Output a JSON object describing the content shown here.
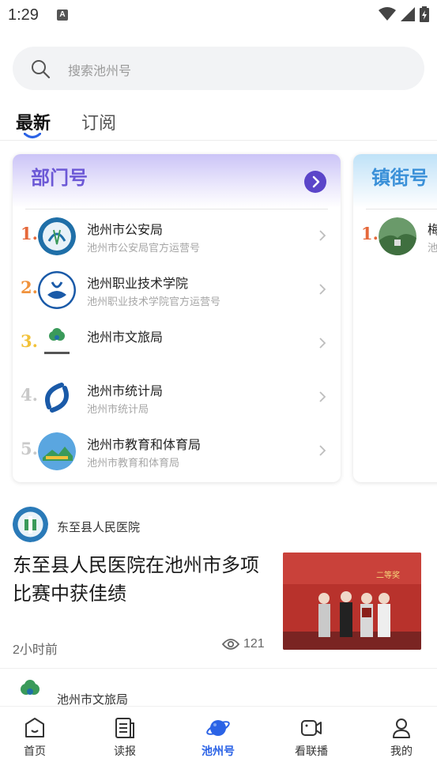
{
  "status_bar": {
    "time": "1:29",
    "notification_letter": "A"
  },
  "search": {
    "placeholder": "搜索池州号"
  },
  "tabs": [
    {
      "label": "最新",
      "active": true
    },
    {
      "label": "订阅",
      "active": false
    }
  ],
  "dept_card": {
    "title": "部门号",
    "items": [
      {
        "rank": "1.",
        "name": "池州市公安局",
        "desc": "池州市公安局官方运营号",
        "rank_color": "#e5683a"
      },
      {
        "rank": "2.",
        "name": "池州职业技术学院",
        "desc": "池州职业技术学院官方运营号",
        "rank_color": "#f0923c"
      },
      {
        "rank": "3.",
        "name": "池州市文旅局",
        "desc": "",
        "rank_color": "#f2c23a"
      },
      {
        "rank": "4.",
        "name": "池州市统计局",
        "desc": "池州市统计局",
        "rank_color": "#c9c9c9"
      },
      {
        "rank": "5.",
        "name": "池州市教育和体育局",
        "desc": "池州市教育和体育局",
        "rank_color": "#c9c9c9"
      }
    ]
  },
  "town_card": {
    "title": "镇街号",
    "items": [
      {
        "rank": "1.",
        "name": "梅",
        "desc": "池",
        "rank_color": "#e5683a"
      }
    ]
  },
  "article": {
    "author": "东至县人民医院",
    "title": "东至县人民医院在池州市多项比赛中获佳绩",
    "time": "2小时前",
    "views": "121",
    "thumb_banner": "二等奖"
  },
  "next_article": {
    "author": "池州市文旅局"
  },
  "bottom_nav": [
    {
      "label": "首页",
      "icon": "home-icon",
      "active": false
    },
    {
      "label": "读报",
      "icon": "newspaper-icon",
      "active": false
    },
    {
      "label": "池州号",
      "icon": "planet-icon",
      "active": true
    },
    {
      "label": "看联播",
      "icon": "video-icon",
      "active": false
    },
    {
      "label": "我的",
      "icon": "profile-icon",
      "active": false
    }
  ],
  "colors": {
    "accent": "#2b63e6",
    "dept_title": "#6c58d6",
    "town_title": "#3a90d8"
  }
}
